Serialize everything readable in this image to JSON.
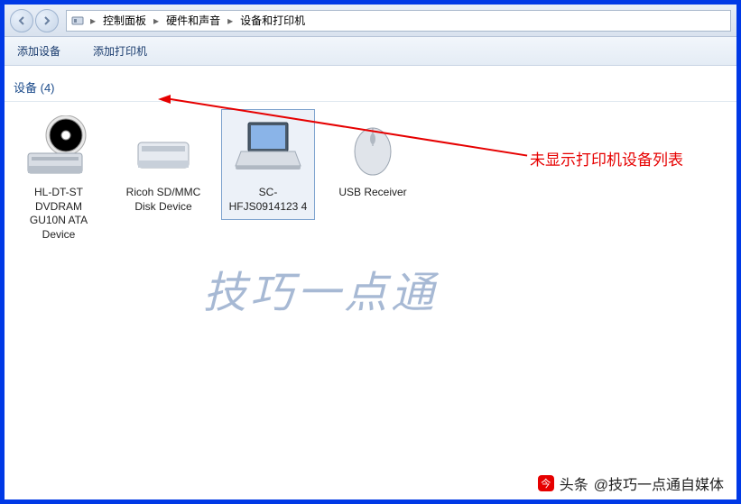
{
  "breadcrumb": {
    "items": [
      "控制面板",
      "硬件和声音",
      "设备和打印机"
    ]
  },
  "toolbar": {
    "add_device": "添加设备",
    "add_printer": "添加打印机"
  },
  "section": {
    "devices_header": "设备 (4)"
  },
  "devices": [
    {
      "label": "HL-DT-ST DVDRAM GU10N ATA Device",
      "icon": "optical-drive",
      "selected": false
    },
    {
      "label": "Ricoh SD/MMC Disk Device",
      "icon": "card-reader",
      "selected": false
    },
    {
      "label": "SC-HFJS0914123\n4",
      "icon": "laptop",
      "selected": true
    },
    {
      "label": "USB Receiver",
      "icon": "mouse",
      "selected": false
    }
  ],
  "annotation": {
    "text": "未显示打印机设备列表"
  },
  "watermark": "技巧一点通",
  "footer": {
    "prefix": "头条",
    "credit": "@技巧一点通自媒体"
  }
}
